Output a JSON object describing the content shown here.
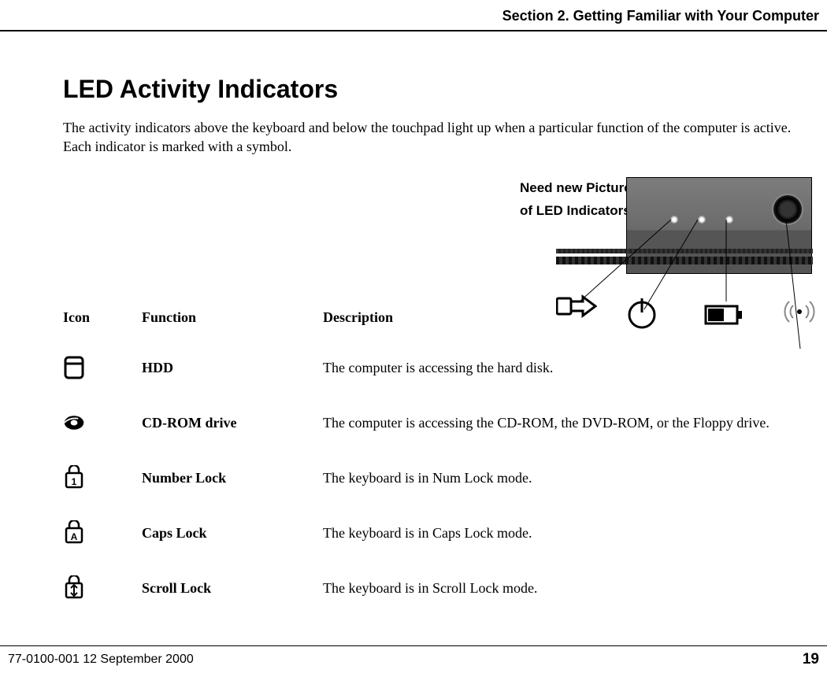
{
  "header": {
    "section": "Section 2. Getting Familiar with Your Computer"
  },
  "title": "LED Activity Indicators",
  "intro": "The activity indicators above the keyboard and below the touchpad light up when a particular function of the computer is active. Each indicator is marked with a symbol.",
  "note": {
    "line1": "Need new Picture",
    "line2": "of LED Indicators!"
  },
  "callout_icons": [
    "plug-icon",
    "power-icon",
    "battery-icon",
    "wireless-icon"
  ],
  "table": {
    "headers": {
      "icon": "Icon",
      "function": "Function",
      "description": "Description"
    },
    "rows": [
      {
        "icon": "hdd-icon",
        "function": "HDD",
        "description": "The computer is accessing the hard disk."
      },
      {
        "icon": "cdrom-icon",
        "function": "CD-ROM drive",
        "description": "The computer is accessing the CD-ROM, the DVD-ROM, or the Floppy drive."
      },
      {
        "icon": "numlock-icon",
        "function": "Number Lock",
        "description": "The keyboard is in Num Lock mode."
      },
      {
        "icon": "capslock-icon",
        "function": "Caps Lock",
        "description": "The keyboard is in Caps Lock mode."
      },
      {
        "icon": "scrolllock-icon",
        "function": "Scroll Lock",
        "description": "The keyboard is in Scroll Lock mode."
      }
    ]
  },
  "footer": {
    "left": "77-0100-001   12 September 2000",
    "right": "19"
  }
}
